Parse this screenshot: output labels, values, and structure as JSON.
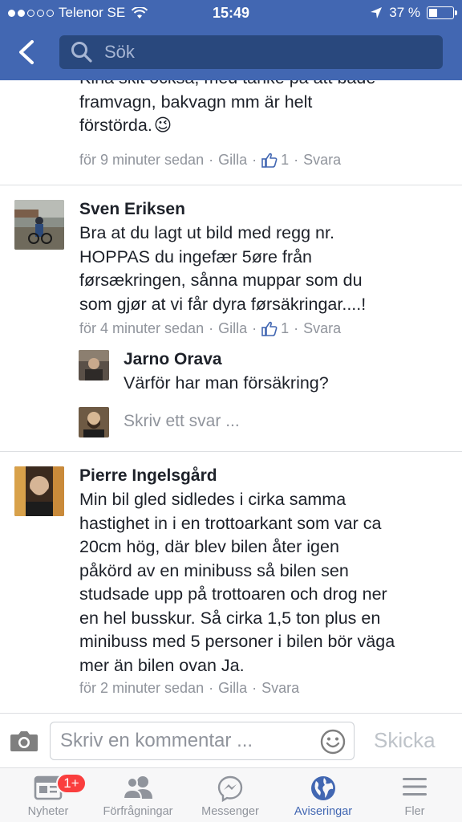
{
  "status_bar": {
    "carrier": "Telenor SE",
    "time": "15:49",
    "battery": "37 %",
    "icons": [
      "signal-dots",
      "wifi-icon",
      "location-arrow-icon",
      "battery-icon"
    ]
  },
  "search": {
    "placeholder": "Sök"
  },
  "comments": [
    {
      "text": "Kina skit också, med tanke på att både framvagn, bakvagn mm är helt förstörda.",
      "text_line1": "Kina skit också, med tanke på att både",
      "text_line2": "framvagn, bakvagn mm är helt",
      "text_line3": "förstörda.",
      "emoji": "😉",
      "time": "för 9 minuter sedan",
      "like": "Gilla",
      "like_count": "1",
      "reply": "Svara"
    },
    {
      "author": "Sven Eriksen",
      "text_line1": "Bra at du lagt ut bild med regg nr.",
      "text_line2": "HOPPAS du ingefær 5øre från",
      "text_line3": "førsækringen, sånna muppar som du",
      "text_line4": "som gjør at vi får dyra førsäkringar....!",
      "time": "för 4 minuter sedan",
      "like": "Gilla",
      "like_count": "1",
      "reply": "Svara",
      "replies": [
        {
          "author": "Jarno Orava",
          "text": "Värför har man försäkring?"
        }
      ],
      "reply_placeholder": "Skriv ett svar ..."
    },
    {
      "author": "Pierre Ingelsgård",
      "lines": [
        "Min bil gled sidledes i cirka samma",
        "hastighet in i en trottoarkant som var ca",
        "20cm hög, där blev bilen åter igen",
        "påkörd av en minibuss så bilen sen",
        "studsade upp på trottoaren och drog ner",
        "en hel busskur. Så cirka 1,5 ton plus en",
        "minibuss med 5 personer i bilen bör väga",
        "mer än bilen ovan Ja."
      ],
      "time": "för 2 minuter sedan",
      "like": "Gilla",
      "reply": "Svara"
    }
  ],
  "composer": {
    "placeholder": "Skriv en kommentar ...",
    "send": "Skicka"
  },
  "tabs": [
    {
      "label": "Nyheter",
      "icon": "news-feed-icon",
      "badge": "1+"
    },
    {
      "label": "Förfrågningar",
      "icon": "friend-requests-icon"
    },
    {
      "label": "Messenger",
      "icon": "messenger-icon"
    },
    {
      "label": "Aviseringar",
      "icon": "globe-icon",
      "active": true
    },
    {
      "label": "Fler",
      "icon": "menu-icon"
    }
  ],
  "colors": {
    "brand": "#4267b2",
    "badge": "#fa3e3e",
    "meta": "#90949c"
  }
}
